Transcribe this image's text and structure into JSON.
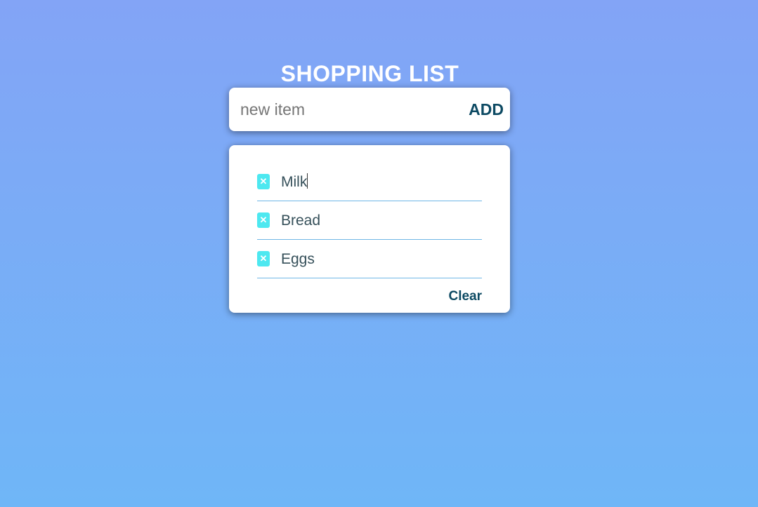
{
  "app": {
    "title": "SHOPPING LIST"
  },
  "add_form": {
    "placeholder": "new item",
    "value": "",
    "add_label": "ADD"
  },
  "list": {
    "items": [
      {
        "label": "Milk",
        "remove_glyph": "✕"
      },
      {
        "label": "Bread",
        "remove_glyph": "✕"
      },
      {
        "label": "Eggs",
        "remove_glyph": "✕"
      }
    ],
    "clear_label": "Clear"
  },
  "colors": {
    "background_top": "#83a4f6",
    "background_bottom": "#6fb6f7",
    "accent_text": "#0d4a63",
    "remove_button": "#4de8f0",
    "divider": "#6fb6e6"
  }
}
